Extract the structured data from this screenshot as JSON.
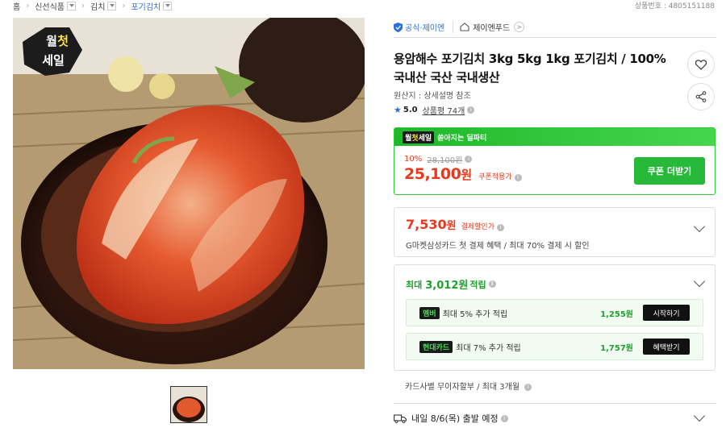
{
  "breadcrumb": [
    {
      "label": "홈",
      "dropdown": false
    },
    {
      "label": "신선식품",
      "dropdown": true
    },
    {
      "label": "김치",
      "dropdown": true
    },
    {
      "label": "포기김치",
      "dropdown": true
    }
  ],
  "product_no": "상품번호 : 4805151188",
  "image": {
    "badge_top": "월",
    "badge_mid": "첫",
    "badge_bottom": "세일"
  },
  "store": {
    "official_label": "공식·제이엔",
    "store_name": "제이엔푸드",
    "store_arrow": ">"
  },
  "title": "용암해수 포기김치 3kg 5kg 1kg 포기김치 / 100% 국내산 국산 국내생산",
  "origin": "원산지 : 상세설명 참조",
  "rating": {
    "star": "★",
    "score": "5.0",
    "reviews": "상품평 74개",
    "info": "i"
  },
  "deal": {
    "logo_a": "월",
    "logo_b": "첫",
    "logo_c": "세일",
    "headline": "쏟아지는 딜파티",
    "discount": "10%",
    "original_price": "28,100원",
    "price": "25,100",
    "price_unit": "원",
    "price_label": "쿠폰적용가",
    "coupon_button": "쿠폰 더받기"
  },
  "card_price": {
    "price": "7,530",
    "unit": "원",
    "label": "결제할인가",
    "description": "G마켓삼성카드 첫 결제 혜택 / 최대 70% 결제 시 할인"
  },
  "points": {
    "prefix": "최대",
    "amount": "3,012원",
    "suffix": "적립",
    "rows": [
      {
        "badge": "멤버",
        "text": "최대 5% 추가 적립",
        "amount": "1,255원",
        "button": "시작하기"
      },
      {
        "badge": "현대카드",
        "text": "최대 7% 추가 적립",
        "amount": "1,757원",
        "button": "혜택받기"
      }
    ]
  },
  "installment": "카드사별 무이자할부 / 최대 3개월",
  "shipping": "내일 8/6(목) 출발 예정",
  "colors": {
    "accent_red": "#e8391e",
    "accent_green": "#27b93a",
    "link_blue": "#2f6fd6"
  },
  "icons": [
    "heart-icon",
    "share-icon",
    "home-icon",
    "official-badge-icon",
    "truck-icon",
    "info-icon",
    "chevron-down-icon"
  ]
}
